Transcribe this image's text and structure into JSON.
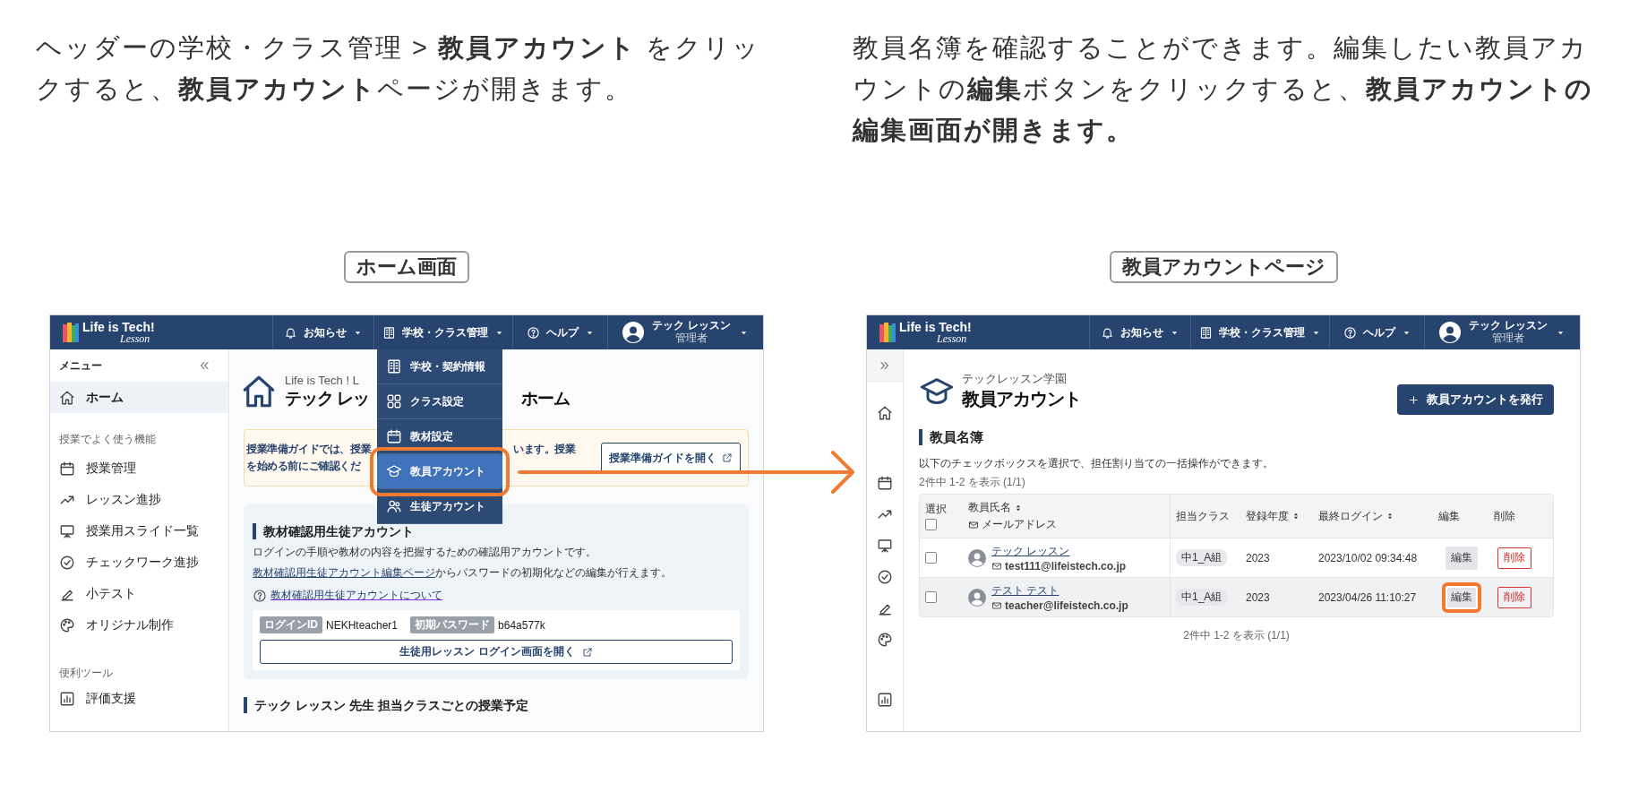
{
  "intro": [
    {
      "text": "ヘッダーの学校・クラス管理 > **教員アカウント** をクリックすると、**教員アカウント**ページが開きます。"
    },
    {
      "text": "教員名簿を確認することができます。編集したい教員アカウントの**編集**ボタンをクリックすると、**教員アカウントの編集画面が開きます。**"
    }
  ],
  "home_screen": {
    "caption": "ホーム画面",
    "header": {
      "logo": {
        "title": "Life is Tech!",
        "subtitle": "Lesson"
      },
      "nav": [
        {
          "label": "お知らせ"
        },
        {
          "label": "学校・クラス管理"
        },
        {
          "label": "ヘルプ"
        }
      ],
      "user": {
        "name": "テック レッスン",
        "role": "管理者"
      }
    },
    "sidebar": {
      "title": "メニュー",
      "groups": [
        {
          "items": [
            {
              "label": "ホーム",
              "selected": true
            }
          ]
        },
        {
          "heading": "授業でよく使う機能",
          "items": [
            {
              "label": "授業管理",
              "selected": false
            },
            {
              "label": "レッスン進捗",
              "selected": false
            },
            {
              "label": "授業用スライド一覧",
              "selected": false
            },
            {
              "label": "チェックワーク進捗",
              "selected": false
            },
            {
              "label": "小テスト",
              "selected": false
            },
            {
              "label": "オリジナル制作",
              "selected": false
            }
          ]
        },
        {
          "heading": "便利ツール",
          "items": [
            {
              "label": "評価支援",
              "selected": false
            }
          ]
        }
      ]
    },
    "main": {
      "subtitle": "Life is Tech ! L",
      "title_left": "テック レッ",
      "title_right": "ホーム",
      "guide": {
        "lines": [
          {
            "left": "授業準備ガイドでは、授業",
            "right": "います。授業"
          },
          {
            "left": "を始める前にご確認くだ"
          }
        ],
        "button": "授業準備ガイドを開く"
      },
      "account": {
        "title": "教材確認用生徒アカウント",
        "description": "ログインの手順や教材の内容を把握するための確認用アカウントです。",
        "edit_link": "教材確認用生徒アカウント編集ページ",
        "edit_text": "からパスワードの初期化などの編集が行えます。",
        "help_link": "教材確認用生徒アカウントについて",
        "credentials": [
          {
            "label": "ログインID",
            "value": "NEKHteacher1"
          },
          {
            "label": "初期パスワード",
            "value": "b64a577k"
          }
        ],
        "open_button": "生徒用レッスン ログイン画面を開く"
      },
      "schedule_title": "テック レッスン 先生 担当クラスごとの授業予定"
    },
    "dropdown": {
      "items": [
        {
          "label": "学校・契約情報",
          "selected": false,
          "highlighted": false
        },
        {
          "label": "クラス設定",
          "selected": false,
          "highlighted": false
        },
        {
          "label": "教材設定",
          "selected": false,
          "highlighted": false
        },
        {
          "label": "教員アカウント",
          "selected": true,
          "highlighted": true
        },
        {
          "label": "生徒アカウント",
          "selected": false,
          "highlighted": false
        }
      ]
    }
  },
  "account_screen": {
    "caption": "教員アカウントページ",
    "header": {
      "logo": {
        "title": "Life is Tech!",
        "subtitle": "Lesson"
      },
      "nav": [
        {
          "label": "お知らせ"
        },
        {
          "label": "学校・クラス管理"
        },
        {
          "label": "ヘルプ"
        }
      ],
      "user": {
        "name": "テック レッスン",
        "role": "管理者"
      }
    },
    "main": {
      "school": "テックレッスン学園",
      "title": "教員アカウント",
      "issue_button": "教員アカウントを発行",
      "section_title": "教員名簿",
      "description": "以下のチェックボックスを選択で、担任割り当ての一括操作ができます。",
      "count_top": "2件中 1-2 を表示 (1/1)",
      "table": {
        "select_all_checked": false,
        "columns": [
          {
            "label": "選択",
            "sortable": false
          },
          {
            "label": "教員氏名",
            "sortable": true,
            "sublabel": "メールアドレス"
          },
          {
            "label": "担当クラス",
            "sortable": false
          },
          {
            "label": "登録年度",
            "sortable": true
          },
          {
            "label": "最終ログイン",
            "sortable": true
          },
          {
            "label": "編集",
            "sortable": false
          },
          {
            "label": "削除",
            "sortable": false
          }
        ],
        "rows": [
          {
            "checked": false,
            "hovered": false,
            "name": "テック レッスン",
            "email": "test111@lifeistech.co.jp",
            "class": "中1_A組",
            "year": "2023",
            "last_login": "2023/10/02 09:34:48",
            "edit": "編集",
            "delete": "削除",
            "edit_highlighted": false
          },
          {
            "checked": false,
            "hovered": true,
            "name": "テスト テスト",
            "email": "teacher@lifeistech.co.jp",
            "class": "中1_A組",
            "year": "2023",
            "last_login": "2023/04/26 11:10:27",
            "edit": "編集",
            "delete": "削除",
            "edit_highlighted": true
          }
        ]
      },
      "count_bottom": "2件中 1-2 を表示 (1/1)"
    }
  }
}
